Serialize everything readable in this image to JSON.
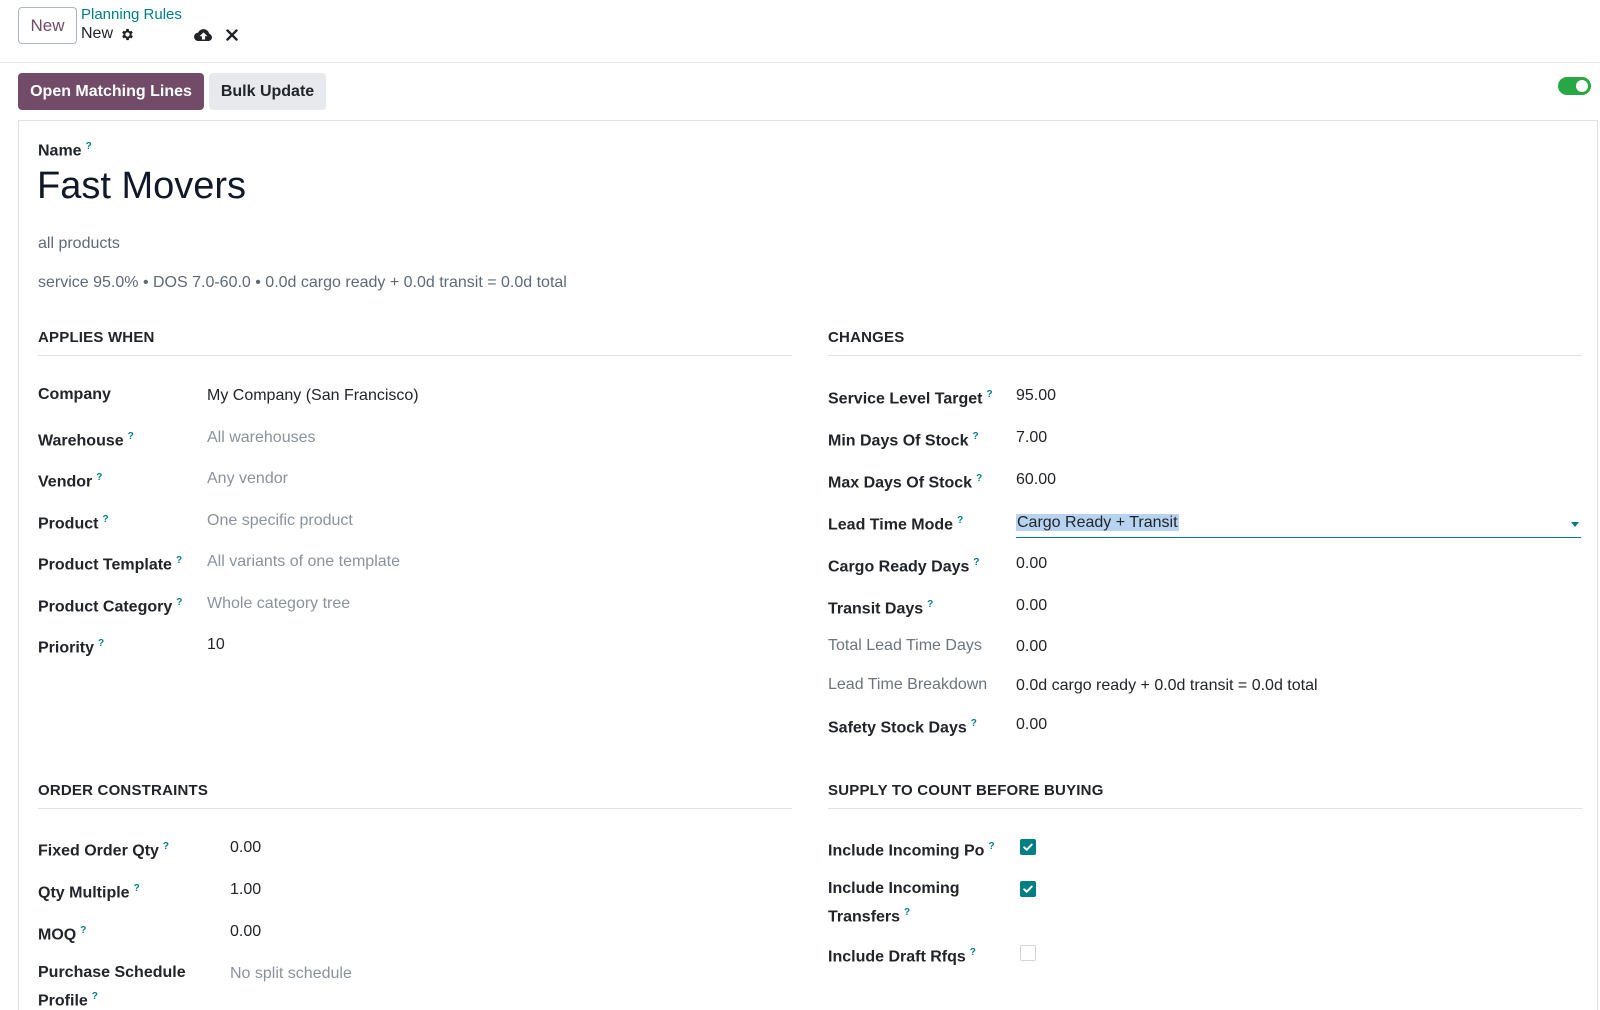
{
  "control_panel": {
    "new_button": "New",
    "breadcrumb_parent": "Planning Rules",
    "breadcrumb_current": "New"
  },
  "actions": {
    "open_matching_lines": "Open Matching Lines",
    "bulk_update": "Bulk Update",
    "active_toggle": true
  },
  "record": {
    "name_label": "Name",
    "name": "Fast Movers",
    "scope_summary": "all products",
    "policy_summary": "service 95.0% • DOS 7.0-60.0 • 0.0d cargo ready + 0.0d transit = 0.0d total"
  },
  "applies_when": {
    "heading": "APPLIES WHEN",
    "fields": [
      {
        "label": "Company",
        "value": "My Company (San Francisco)",
        "help": false,
        "placeholder": false
      },
      {
        "label": "Warehouse",
        "value": "All warehouses",
        "help": true,
        "placeholder": true
      },
      {
        "label": "Vendor",
        "value": "Any vendor",
        "help": true,
        "placeholder": true
      },
      {
        "label": "Product",
        "value": "One specific product",
        "help": true,
        "placeholder": true
      },
      {
        "label": "Product Template",
        "value": "All variants of one template",
        "help": true,
        "placeholder": true
      },
      {
        "label": "Product Category",
        "value": "Whole category tree",
        "help": true,
        "placeholder": true
      },
      {
        "label": "Priority",
        "value": "10",
        "help": true,
        "placeholder": false
      }
    ]
  },
  "changes": {
    "heading": "CHANGES",
    "fields": [
      {
        "label": "Service Level Target",
        "value": "95.00",
        "help": true
      },
      {
        "label": "Min Days Of Stock",
        "value": "7.00",
        "help": true
      },
      {
        "label": "Max Days Of Stock",
        "value": "60.00",
        "help": true
      },
      {
        "label": "Lead Time Mode",
        "value": "Cargo Ready + Transit",
        "help": true
      },
      {
        "label": "Cargo Ready Days",
        "value": "0.00",
        "help": true
      },
      {
        "label": "Transit Days",
        "value": "0.00",
        "help": true
      },
      {
        "label": "Total Lead Time Days",
        "value": "0.00",
        "help": false
      },
      {
        "label": "Lead Time Breakdown",
        "value": "0.0d cargo ready + 0.0d transit = 0.0d total",
        "help": false
      },
      {
        "label": "Safety Stock Days",
        "value": "0.00",
        "help": true
      }
    ]
  },
  "order_constraints": {
    "heading": "ORDER CONSTRAINTS",
    "fields": [
      {
        "label": "Fixed Order Qty",
        "value": "0.00",
        "help": true
      },
      {
        "label": "Qty Multiple",
        "value": "1.00",
        "help": true
      },
      {
        "label": "MOQ",
        "value": "0.00",
        "help": true
      },
      {
        "label_line1": "Purchase Schedule",
        "label_line2": "Profile",
        "value": "No split schedule",
        "help": true
      }
    ]
  },
  "supply": {
    "heading": "SUPPLY TO COUNT BEFORE BUYING",
    "fields": [
      {
        "label": "Include Incoming Po",
        "checked": true,
        "help": true
      },
      {
        "label_line1": "Include Incoming",
        "label_line2": "Transfers",
        "checked": true,
        "help": true
      },
      {
        "label": "Include Draft Rfqs",
        "checked": false,
        "help": true
      }
    ]
  },
  "help_marker": "?",
  "icons": {
    "gear": "gear-icon",
    "save": "cloud-upload-icon",
    "discard": "close-icon",
    "dropdown": "caret-down-icon"
  },
  "colors": {
    "primary": "#714b67",
    "accent": "#017e84",
    "toggle_on": "#28a745",
    "selection": "#b8d3ef"
  }
}
